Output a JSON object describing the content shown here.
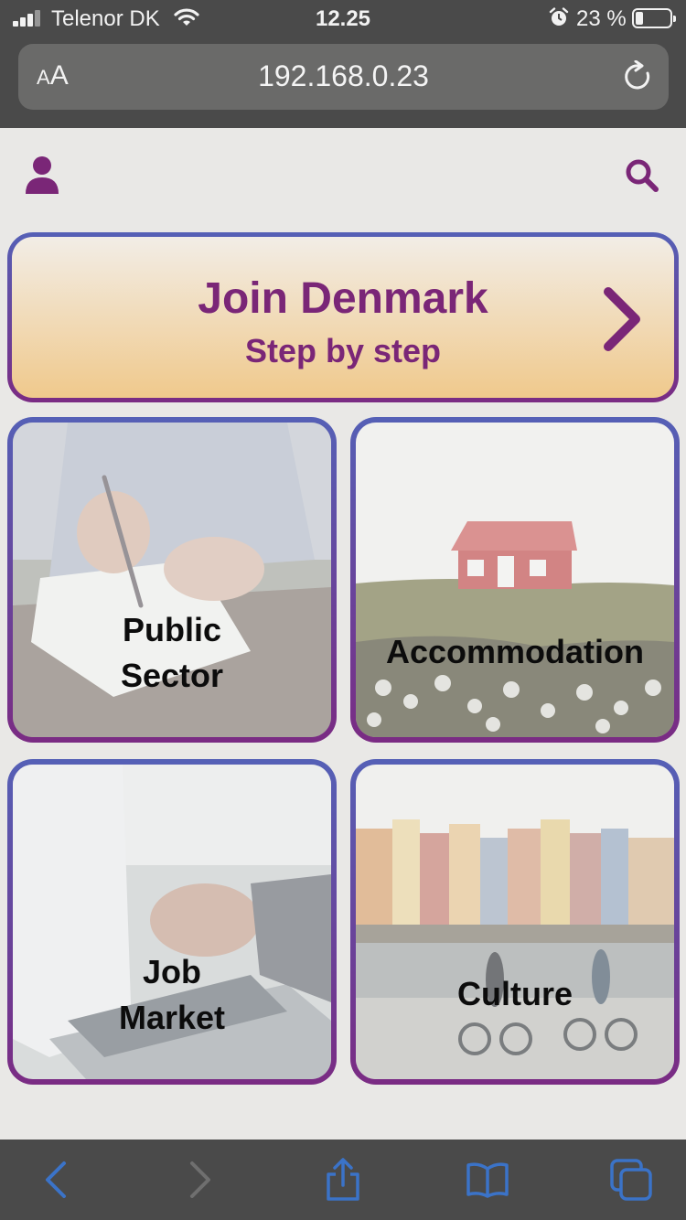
{
  "status_bar": {
    "carrier": "Telenor DK",
    "time": "12.25",
    "battery_percent": "23 %",
    "battery_level": 0.23
  },
  "browser": {
    "text_size_label_small": "A",
    "text_size_label_large": "A",
    "url": "192.168.0.23"
  },
  "banner": {
    "title": "Join Denmark",
    "subtitle": "Step by step"
  },
  "tiles": [
    {
      "label": "Public\nSector"
    },
    {
      "label": "Accommodation"
    },
    {
      "label": "Job\nMarket"
    },
    {
      "label": "Culture"
    }
  ],
  "colors": {
    "brand_purple": "#7a2677",
    "border_blue": "#5560b6",
    "banner_orange": "#f0c98c",
    "toolbar_icon_blue": "#3b73c8"
  },
  "icons": {
    "header_left": "user-icon",
    "header_right": "search-icon",
    "banner_arrow": "chevron-right-icon",
    "toolbar": [
      "back-icon",
      "forward-icon",
      "share-icon",
      "bookmarks-icon",
      "tabs-icon"
    ]
  }
}
